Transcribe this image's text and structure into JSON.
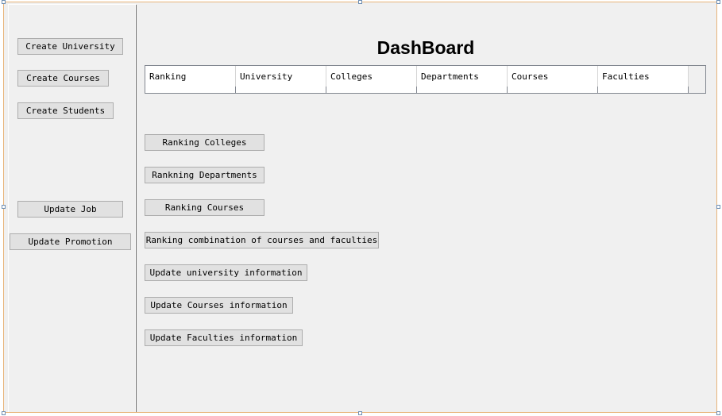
{
  "dashboard": {
    "title": "DashBoard"
  },
  "sidebar": {
    "buttons": [
      {
        "label": "Create University"
      },
      {
        "label": "Create Courses"
      },
      {
        "label": "Create Students"
      },
      {
        "label": "Update Job"
      },
      {
        "label": "Update Promotion"
      }
    ]
  },
  "ranking_table": {
    "columns": [
      "Ranking",
      "University",
      "Colleges",
      "Departments",
      "Courses",
      "Faculties"
    ]
  },
  "actions": {
    "buttons": [
      {
        "label": "Ranking Colleges"
      },
      {
        "label": "Rankning Departments"
      },
      {
        "label": "Ranking Courses"
      },
      {
        "label": "Ranking combination of courses and faculties"
      },
      {
        "label": "Update university information"
      },
      {
        "label": "Update Courses information"
      },
      {
        "label": "Update Faculties information"
      }
    ]
  },
  "colors": {
    "window_bg": "#f0f0f0",
    "window_border": "#e8b47a",
    "button_bg": "#e1e1e1",
    "button_border": "#adadad"
  }
}
